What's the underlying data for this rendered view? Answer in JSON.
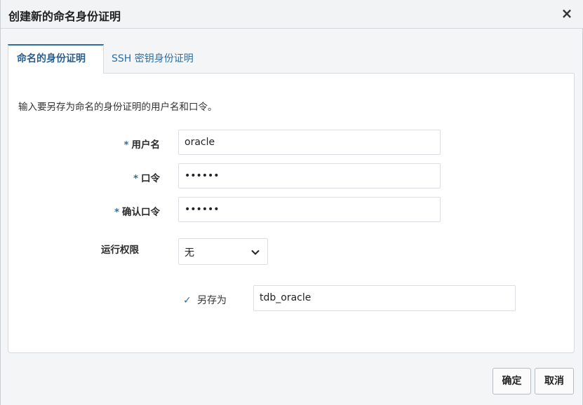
{
  "dialog": {
    "title": "创建新的命名身份证明",
    "close_glyph": "×"
  },
  "tabs": [
    {
      "label": "命名的身份证明",
      "active": true
    },
    {
      "label": "SSH 密钥身份证明",
      "active": false
    }
  ],
  "form": {
    "intro": "输入要另存为命名的身份证明的用户名和口令。",
    "required_mark": "*",
    "username": {
      "label": "用户名",
      "value": "oracle"
    },
    "password": {
      "label": "口令",
      "value": "••••••"
    },
    "confirm_password": {
      "label": "确认口令",
      "value": "••••••"
    },
    "run_privilege": {
      "label": "运行权限",
      "value": "无"
    },
    "save_as": {
      "label": "另存为",
      "checked": true,
      "check_glyph": "✓",
      "value": "tdb_oracle"
    }
  },
  "buttons": {
    "ok": "确定",
    "cancel": "取消"
  },
  "colors": {
    "accent": "#2f6ea0"
  }
}
